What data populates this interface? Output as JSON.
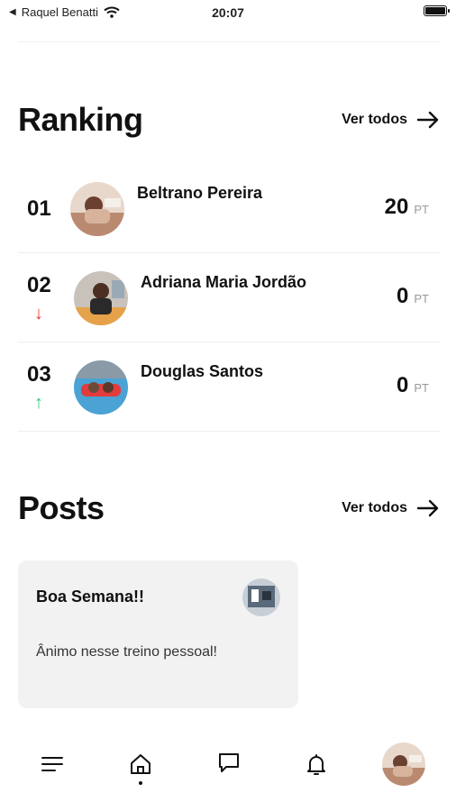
{
  "status_bar": {
    "back_app": "Raquel Benatti",
    "time": "20:07"
  },
  "ranking": {
    "title": "Ranking",
    "see_all": "Ver todos",
    "rows": [
      {
        "position": "01",
        "name": "Beltrano Pereira",
        "points": "20",
        "unit": "PT",
        "trend": ""
      },
      {
        "position": "02",
        "name": "Adriana Maria Jordão",
        "points": "0",
        "unit": "PT",
        "trend": "↓"
      },
      {
        "position": "03",
        "name": "Douglas Santos",
        "points": "0",
        "unit": "PT",
        "trend": "↑"
      }
    ]
  },
  "posts": {
    "title": "Posts",
    "see_all": "Ver todos",
    "items": [
      {
        "title": "Boa Semana!!",
        "body": "Ânimo nesse treino pessoal!"
      }
    ]
  },
  "nav": {
    "items": [
      "menu-icon",
      "home-icon",
      "chat-icon",
      "bell-icon",
      "profile-avatar"
    ],
    "active": "home-icon"
  },
  "colors": {
    "trend_down": "#e53935",
    "trend_up": "#2ecc71",
    "card_bg": "#f2f2f2"
  }
}
